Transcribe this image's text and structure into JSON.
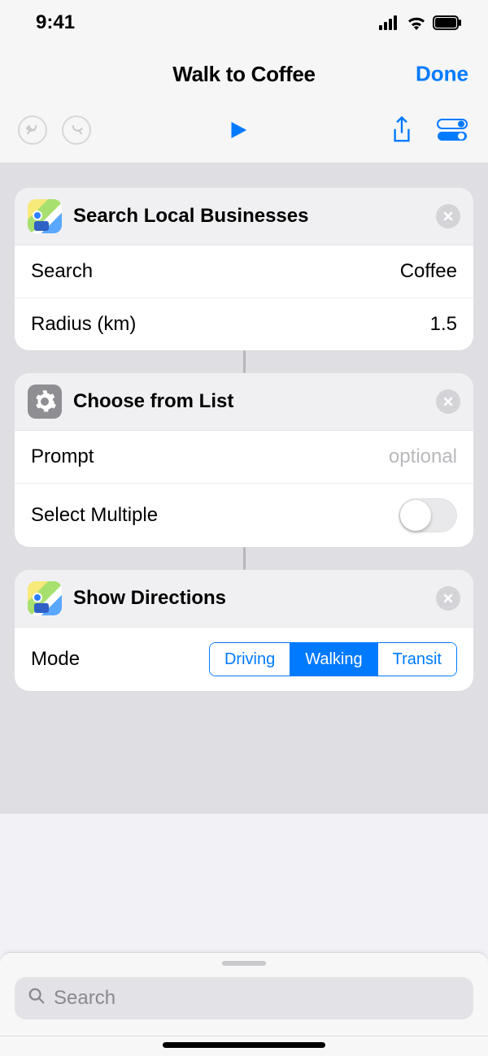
{
  "status": {
    "time": "9:41"
  },
  "nav": {
    "title": "Walk to Coffee",
    "done": "Done"
  },
  "actions": [
    {
      "kind": "maps",
      "title": "Search Local Businesses",
      "rows": [
        {
          "label": "Search",
          "value": "Coffee"
        },
        {
          "label": "Radius (km)",
          "value": "1.5"
        }
      ]
    },
    {
      "kind": "settings",
      "title": "Choose from List",
      "rows": [
        {
          "label": "Prompt",
          "placeholder": "optional"
        },
        {
          "label": "Select Multiple",
          "toggle": false
        }
      ]
    },
    {
      "kind": "maps",
      "title": "Show Directions",
      "rows": [
        {
          "label": "Mode",
          "segments": [
            "Driving",
            "Walking",
            "Transit"
          ],
          "selected": 1
        }
      ]
    }
  ],
  "drawer": {
    "search_placeholder": "Search"
  }
}
